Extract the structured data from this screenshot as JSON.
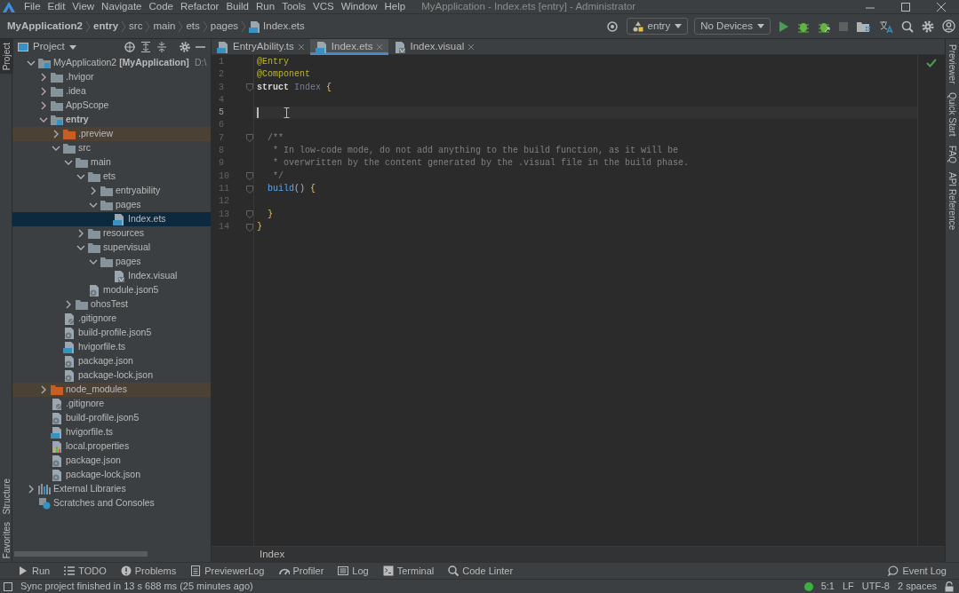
{
  "window": {
    "title": "MyApplication - Index.ets [entry] - Administrator",
    "menu": [
      "File",
      "Edit",
      "View",
      "Navigate",
      "Code",
      "Refactor",
      "Build",
      "Run",
      "Tools",
      "VCS",
      "Window",
      "Help"
    ]
  },
  "breadcrumb": [
    {
      "label": "MyApplication2",
      "bold": true
    },
    {
      "label": "entry",
      "bold": true
    },
    {
      "label": "src",
      "bold": false
    },
    {
      "label": "main",
      "bold": false
    },
    {
      "label": "ets",
      "bold": false
    },
    {
      "label": "pages",
      "bold": false
    },
    {
      "label": "Index.ets",
      "bold": false,
      "kind": "ets"
    }
  ],
  "run_config": {
    "module": "entry",
    "device": "No Devices"
  },
  "left_stripe": [
    {
      "label": "Project",
      "selected": true
    },
    {
      "label": "Structure",
      "selected": false
    },
    {
      "label": "Favorites",
      "selected": false
    }
  ],
  "right_stripe": [
    {
      "label": "Previewer"
    },
    {
      "label": "Quick Start"
    },
    {
      "label": "FAQ"
    },
    {
      "label": "API Reference"
    }
  ],
  "project_panel": {
    "title": "Project",
    "tree": [
      {
        "label": "MyApplication2 **[MyApplication]**",
        "path": "D:\\",
        "kind": "module",
        "expanded": true,
        "selected": false,
        "children": [
          {
            "label": ".hvigor",
            "kind": "folder",
            "expanded": false,
            "selected": false
          },
          {
            "label": ".idea",
            "kind": "folder",
            "expanded": false,
            "selected": false
          },
          {
            "label": "AppScope",
            "kind": "folder",
            "expanded": false,
            "selected": false
          },
          {
            "label": "**entry**",
            "kind": "module",
            "expanded": true,
            "selected": false,
            "children": [
              {
                "label": ".preview",
                "kind": "excluded",
                "expanded": false,
                "selected": false
              },
              {
                "label": "src",
                "kind": "folder",
                "expanded": true,
                "selected": false,
                "children": [
                  {
                    "label": "main",
                    "kind": "folder",
                    "expanded": true,
                    "selected": false,
                    "children": [
                      {
                        "label": "ets",
                        "kind": "folder",
                        "expanded": true,
                        "selected": false,
                        "children": [
                          {
                            "label": "entryability",
                            "kind": "folder",
                            "expanded": false,
                            "selected": false
                          },
                          {
                            "label": "pages",
                            "kind": "folder",
                            "expanded": true,
                            "selected": false,
                            "children": [
                              {
                                "label": "Index.ets",
                                "kind": "ets",
                                "selected": true
                              }
                            ]
                          }
                        ]
                      },
                      {
                        "label": "resources",
                        "kind": "folder",
                        "expanded": false,
                        "selected": false
                      },
                      {
                        "label": "supervisual",
                        "kind": "folder",
                        "expanded": true,
                        "selected": false,
                        "children": [
                          {
                            "label": "pages",
                            "kind": "folder",
                            "expanded": true,
                            "selected": false,
                            "children": [
                              {
                                "label": "Index.visual",
                                "kind": "visual",
                                "selected": false
                              }
                            ]
                          }
                        ]
                      },
                      {
                        "label": "module.json5",
                        "kind": "json",
                        "selected": false
                      }
                    ]
                  },
                  {
                    "label": "ohosTest",
                    "kind": "folder",
                    "expanded": false,
                    "selected": false
                  }
                ]
              },
              {
                "label": ".gitignore",
                "kind": "text",
                "selected": false
              },
              {
                "label": "build-profile.json5",
                "kind": "json",
                "selected": false
              },
              {
                "label": "hvigorfile.ts",
                "kind": "ts",
                "selected": false
              },
              {
                "label": "package.json",
                "kind": "json",
                "selected": false
              },
              {
                "label": "package-lock.json",
                "kind": "json",
                "selected": false
              }
            ]
          },
          {
            "label": "node_modules",
            "kind": "excluded",
            "expanded": false,
            "selected": false
          },
          {
            "label": ".gitignore",
            "kind": "text",
            "selected": false
          },
          {
            "label": "build-profile.json5",
            "kind": "json",
            "selected": false
          },
          {
            "label": "hvigorfile.ts",
            "kind": "ts",
            "selected": false
          },
          {
            "label": "local.properties",
            "kind": "properties",
            "selected": false
          },
          {
            "label": "package.json",
            "kind": "json",
            "selected": false
          },
          {
            "label": "package-lock.json",
            "kind": "json",
            "selected": false
          }
        ]
      },
      {
        "label": "External Libraries",
        "kind": "libraries",
        "expanded": false,
        "selected": false
      },
      {
        "label": "Scratches and Consoles",
        "kind": "scratches",
        "selected": false
      }
    ]
  },
  "editor_tabs": [
    {
      "label": "EntryAbility.ts",
      "kind": "ts",
      "selected": false
    },
    {
      "label": "Index.ets",
      "kind": "ets",
      "selected": true
    },
    {
      "label": "Index.visual",
      "kind": "visual",
      "selected": false
    }
  ],
  "editor": {
    "lines": [
      {
        "number": "1",
        "current": false,
        "tokens": [
          {
            "text": "@Entry",
            "kind": "annotation"
          }
        ]
      },
      {
        "number": "2",
        "current": false,
        "tokens": [
          {
            "text": "@Component",
            "kind": "annotation"
          }
        ]
      },
      {
        "number": "3",
        "current": false,
        "fold": true,
        "tokens": [
          {
            "text": "struct",
            "kind": "keyword"
          },
          {
            "text": " Index",
            "kind": "type"
          },
          {
            "text": " {",
            "kind": "brace"
          }
        ]
      },
      {
        "number": "4",
        "current": false
      },
      {
        "number": "5",
        "current": true
      },
      {
        "number": "6",
        "current": false
      },
      {
        "number": "7",
        "current": false,
        "fold": true,
        "tokens": [
          {
            "text": "  /**",
            "kind": "comment"
          }
        ]
      },
      {
        "number": "8",
        "current": false,
        "tokens": [
          {
            "text": "   * In low-code mode, do not add anything to the build function, as it will be",
            "kind": "comment"
          }
        ]
      },
      {
        "number": "9",
        "current": false,
        "tokens": [
          {
            "text": "   * overwritten by the content generated by the .visual file in the build phase.",
            "kind": "comment"
          }
        ]
      },
      {
        "number": "10",
        "current": false,
        "fold": true,
        "tokens": [
          {
            "text": "   */",
            "kind": "comment"
          }
        ]
      },
      {
        "number": "11",
        "current": false,
        "fold": true,
        "tokens": [
          {
            "text": "  build",
            "kind": "function"
          },
          {
            "text": "() ",
            "kind": "plain"
          },
          {
            "text": "{",
            "kind": "brace"
          }
        ]
      },
      {
        "number": "12",
        "current": false
      },
      {
        "number": "13",
        "current": false,
        "fold": true,
        "tokens": [
          {
            "text": "  }",
            "kind": "brace"
          }
        ]
      },
      {
        "number": "14",
        "current": false,
        "fold": true,
        "tokens": [
          {
            "text": "}",
            "kind": "brace"
          }
        ]
      }
    ],
    "footer": "Index"
  },
  "tool_windows": [
    {
      "label": "Run",
      "kind": "run"
    },
    {
      "label": "TODO",
      "kind": "list"
    },
    {
      "label": "Problems",
      "kind": "problems"
    },
    {
      "label": "PreviewerLog",
      "kind": "doc"
    },
    {
      "label": "Profiler",
      "kind": "gauge"
    },
    {
      "label": "Log",
      "kind": "log"
    },
    {
      "label": "Terminal",
      "kind": "terminal"
    },
    {
      "label": "Code Linter",
      "kind": "search"
    }
  ],
  "event_log": "Event Log",
  "status_bar": {
    "message": "Sync project finished in 13 s 688 ms (25 minutes ago)",
    "position": "5:1",
    "line_separator": "LF",
    "encoding": "UTF-8",
    "indent": "2 spaces"
  }
}
